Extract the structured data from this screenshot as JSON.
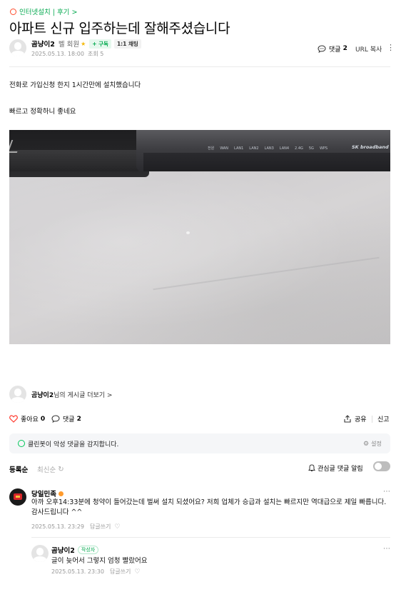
{
  "breadcrumb": {
    "label": "인터넷설치 | 후기 >"
  },
  "post": {
    "title": "아파트 신규 입주하는데 잘해주셨습니다",
    "author": "곰냥이2",
    "grade": "벨 회원",
    "subscribe_label": "+ 구독",
    "chat_label": "1:1 채팅",
    "date": "2025.05.13. 18:00",
    "views": "조회 5",
    "comment_count_label": "댓글",
    "comment_count": "2",
    "url_copy_label": "URL 복사",
    "body_lines": [
      "전화로 가입신청 한지 1시간만에 설치했습니다",
      "빠르고 정확하니 좋네요"
    ],
    "router_brand": "SK broadband",
    "router_leds": [
      "전원",
      "WAN",
      "LAN1",
      "LAN2",
      "LAN3",
      "LAN4",
      "2.4G",
      "5G",
      "WPS"
    ]
  },
  "author_more": {
    "name": "곰냥이2",
    "suffix": "님의 게시글 더보기 >"
  },
  "actions": {
    "like_label": "좋아요",
    "like_count": "0",
    "comment_label": "댓글",
    "comment_count": "2",
    "share_label": "공유",
    "report_label": "신고"
  },
  "cleanbot": {
    "text": "클린봇이 악성 댓글을 감지합니다.",
    "settings_label": "설정"
  },
  "comment_sort": {
    "order_label": "등록순",
    "recent_label": "최신순",
    "watch_label": "관심글 댓글 알림"
  },
  "comments": [
    {
      "author": "당일민족",
      "text": "아까 오후14:33분에 청약이 들어갔는데 벌써 설치 되셨어요? 저희 업체가 승급과 설치는 빠르지만 역대급으로 제일 빠릅니다. 감사드립니다 ^^",
      "date": "2025.05.13. 23:29",
      "reply_label": "답글쓰기"
    },
    {
      "author": "곰냥이2",
      "badge": "작성자",
      "text": "글이 늦어서 그렇지 엄청 빨랐어요",
      "date": "2025.05.13. 23:30",
      "reply_label": "답글쓰기"
    }
  ],
  "colors": {
    "accent_green": "#03c75a",
    "like_red": "#ff3b30",
    "cleanbot_bg": "#f5f6f8"
  }
}
